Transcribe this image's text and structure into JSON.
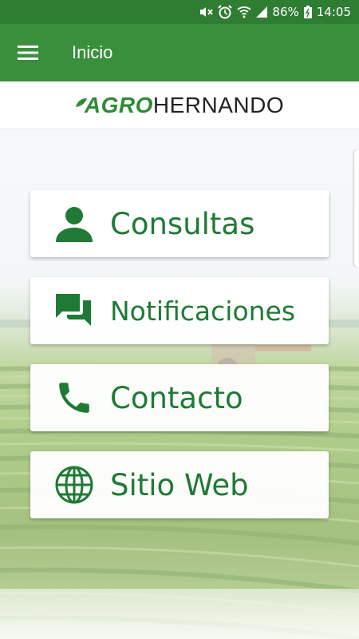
{
  "status_bar": {
    "battery": "86%",
    "time": "14:05",
    "icons": [
      "mute-icon",
      "alarm-icon",
      "wifi-icon",
      "signal-icon",
      "battery-icon"
    ]
  },
  "app_bar": {
    "title": "Inicio",
    "menu_icon": "hamburger-menu-icon",
    "color": "#3a8f3d"
  },
  "logo": {
    "part1": "AGRO",
    "part2": "HERNANDO",
    "accent_color": "#2e8b34"
  },
  "menu": {
    "items": [
      {
        "label": "Consultas",
        "icon": "person-icon"
      },
      {
        "label": "Notificaciones",
        "icon": "chat-icon"
      },
      {
        "label": "Contacto",
        "icon": "phone-icon"
      },
      {
        "label": "Sitio Web",
        "icon": "globe-icon"
      }
    ],
    "label_color": "#1f7a35"
  }
}
